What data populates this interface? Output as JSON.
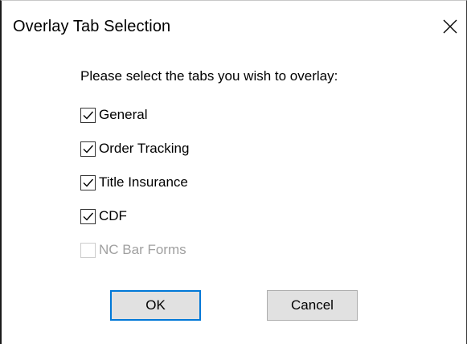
{
  "dialog": {
    "title": "Overlay Tab Selection",
    "close_icon": "close-icon",
    "prompt": "Please select the tabs you wish to overlay:",
    "options": [
      {
        "label": "General",
        "checked": true,
        "enabled": true
      },
      {
        "label": "Order Tracking",
        "checked": true,
        "enabled": true
      },
      {
        "label": "Title Insurance",
        "checked": true,
        "enabled": true
      },
      {
        "label": "CDF",
        "checked": true,
        "enabled": true
      },
      {
        "label": "NC Bar Forms",
        "checked": false,
        "enabled": false
      }
    ],
    "ok_label": "OK",
    "cancel_label": "Cancel"
  },
  "colors": {
    "accent": "#0078d7",
    "button_face": "#e1e1e1",
    "disabled_text": "#a0a0a0"
  }
}
